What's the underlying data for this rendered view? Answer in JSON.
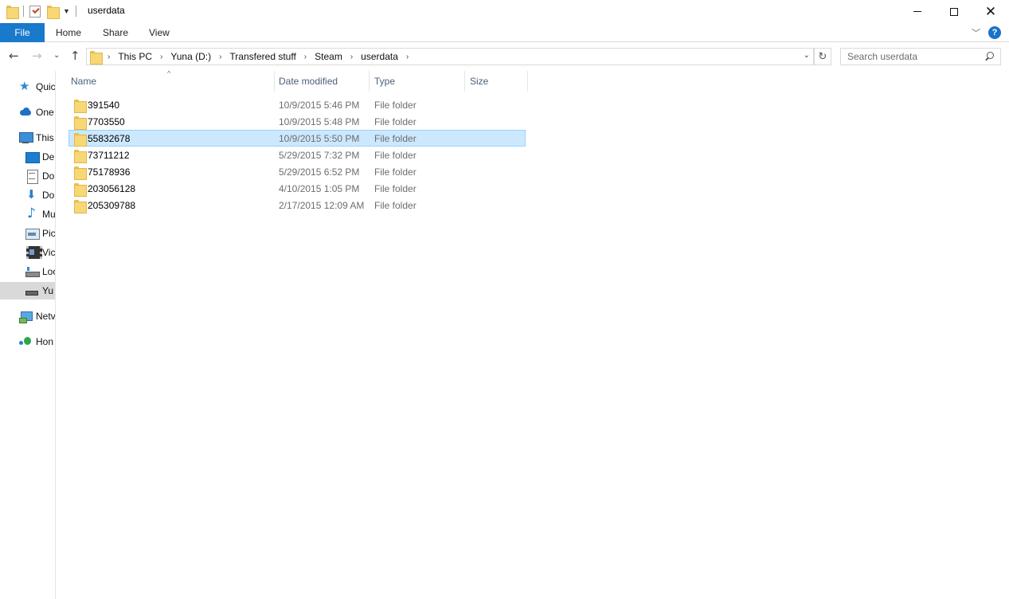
{
  "window": {
    "title": "userdata"
  },
  "ribbon": {
    "file_label": "File",
    "tabs": [
      "Home",
      "Share",
      "View"
    ]
  },
  "address": {
    "crumbs": [
      "This PC",
      "Yuna (D:)",
      "Transfered stuff",
      "Steam",
      "userdata"
    ]
  },
  "search": {
    "placeholder": "Search userdata"
  },
  "nav_pane": {
    "items": [
      {
        "label": "Quic",
        "icon": "quick-access-star-icon"
      },
      {
        "label": "One",
        "icon": "onedrive-cloud-icon"
      },
      {
        "label": "This",
        "icon": "this-pc-icon"
      },
      {
        "label": "De",
        "icon": "desktop-icon"
      },
      {
        "label": "Do",
        "icon": "documents-icon"
      },
      {
        "label": "Do",
        "icon": "downloads-icon"
      },
      {
        "label": "Mu",
        "icon": "music-icon"
      },
      {
        "label": "Pic",
        "icon": "pictures-icon"
      },
      {
        "label": "Vic",
        "icon": "videos-icon"
      },
      {
        "label": "Loc",
        "icon": "local-disk-icon"
      },
      {
        "label": "Yu",
        "icon": "drive-icon",
        "selected": true
      },
      {
        "label": "Netv",
        "icon": "network-icon"
      },
      {
        "label": "Hon",
        "icon": "homegroup-icon"
      }
    ]
  },
  "columns": {
    "name": "Name",
    "date": "Date modified",
    "type": "Type",
    "size": "Size"
  },
  "files": [
    {
      "name": "391540",
      "date": "10/9/2015 5:46 PM",
      "type": "File folder"
    },
    {
      "name": "7703550",
      "date": "10/9/2015 5:48 PM",
      "type": "File folder"
    },
    {
      "name": "55832678",
      "date": "10/9/2015 5:50 PM",
      "type": "File folder",
      "selected": true
    },
    {
      "name": "73711212",
      "date": "5/29/2015 7:32 PM",
      "type": "File folder"
    },
    {
      "name": "75178936",
      "date": "5/29/2015 6:52 PM",
      "type": "File folder"
    },
    {
      "name": "203056128",
      "date": "4/10/2015 1:05 PM",
      "type": "File folder"
    },
    {
      "name": "205309788",
      "date": "2/17/2015 12:09 AM",
      "type": "File folder"
    }
  ],
  "colors": {
    "accent": "#1979ca",
    "selection": "#cce8ff",
    "selection_border": "#99d1ff"
  }
}
